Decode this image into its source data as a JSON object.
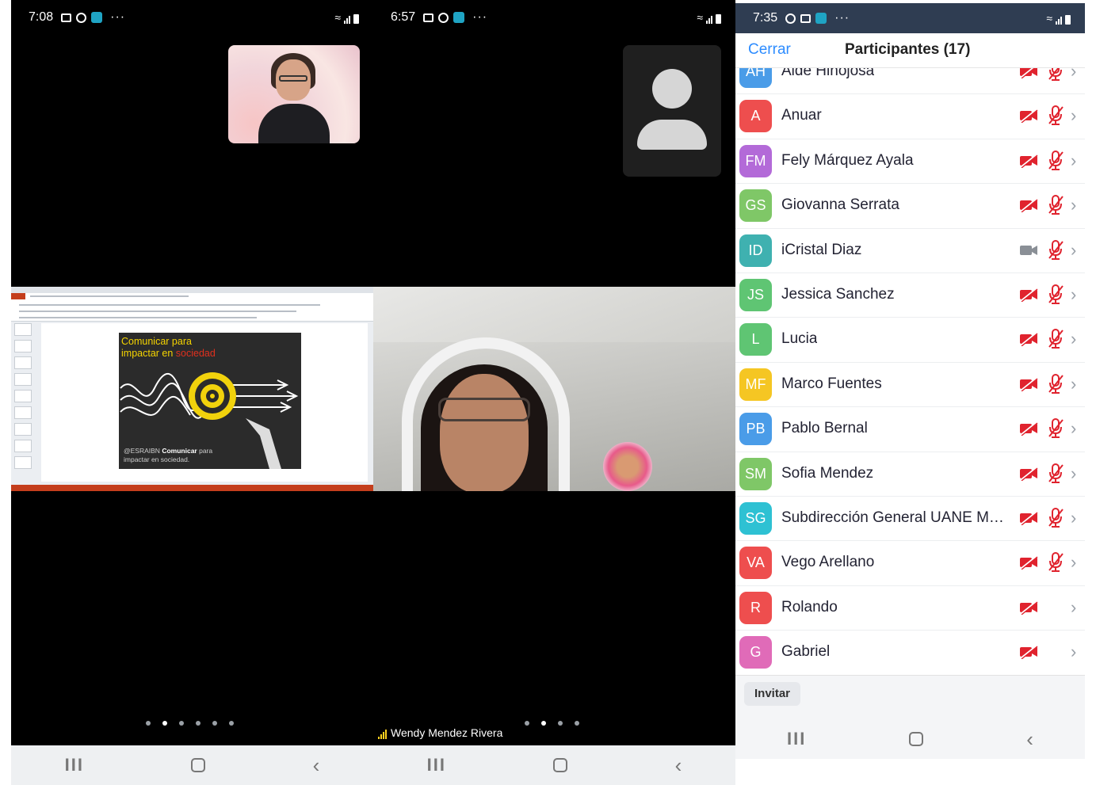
{
  "phone1": {
    "status": {
      "time": "7:08"
    },
    "page_dots": {
      "count": 6,
      "active": 1
    },
    "slide": {
      "title_line1": "Comunicar para",
      "title_line2_prefix": "impactar en ",
      "title_line2_highlight": "sociedad",
      "footer_handle": "@ESRAIBN",
      "footer_bold": "Comunicar",
      "footer_rest1": " para",
      "footer_line2": "impactar en sociedad."
    }
  },
  "phone2": {
    "status": {
      "time": "6:57"
    },
    "speaker_name": "Wendy Mendez Rivera",
    "page_dots": {
      "count": 4,
      "active": 1
    }
  },
  "phone3": {
    "status": {
      "time": "7:35"
    },
    "header": {
      "close_label": "Cerrar",
      "title": "Participantes (17)"
    },
    "participants": [
      {
        "initials": "AH",
        "name": "Aide Hinojosa",
        "color": "#4a9ce8",
        "video": "off",
        "mic": "muted"
      },
      {
        "initials": "A",
        "name": "Anuar",
        "color": "#ee4e4e",
        "video": "off",
        "mic": "muted"
      },
      {
        "initials": "FM",
        "name": "Fely Márquez Ayala",
        "color": "#b36ad8",
        "video": "off",
        "mic": "muted"
      },
      {
        "initials": "GS",
        "name": "Giovanna Serrata",
        "color": "#7fc767",
        "video": "off",
        "mic": "muted"
      },
      {
        "initials": "ID",
        "name": "iCristal Diaz",
        "color": "#3fb1b0",
        "video": "on",
        "mic": "muted"
      },
      {
        "initials": "JS",
        "name": "Jessica Sanchez",
        "color": "#5fc573",
        "video": "off",
        "mic": "muted"
      },
      {
        "initials": "L",
        "name": "Lucia",
        "color": "#5fc573",
        "video": "off",
        "mic": "muted"
      },
      {
        "initials": "MF",
        "name": "Marco Fuentes",
        "color": "#f5c623",
        "video": "off",
        "mic": "muted"
      },
      {
        "initials": "PB",
        "name": "Pablo Bernal",
        "color": "#4a9ce8",
        "video": "off",
        "mic": "muted"
      },
      {
        "initials": "SM",
        "name": "Sofia Mendez",
        "color": "#7fc767",
        "video": "off",
        "mic": "muted"
      },
      {
        "initials": "SG",
        "name": "Subdirección General UANE MAT...",
        "color": "#2ec1d3",
        "video": "off",
        "mic": "muted"
      },
      {
        "initials": "VA",
        "name": "Vego Arellano",
        "color": "#ee4e4e",
        "video": "off",
        "mic": "muted"
      },
      {
        "initials": "R",
        "name": "Rolando",
        "color": "#ee4e4e",
        "video": "off",
        "mic": "none"
      },
      {
        "initials": "G",
        "name": "Gabriel",
        "color": "#e06bb8",
        "video": "off",
        "mic": "none"
      }
    ],
    "invite_label": "Invitar"
  },
  "colors": {
    "zoom_blue": "#2d8cff",
    "muted_red": "#e0232e",
    "status_bar_dark": "#2f3d52"
  }
}
